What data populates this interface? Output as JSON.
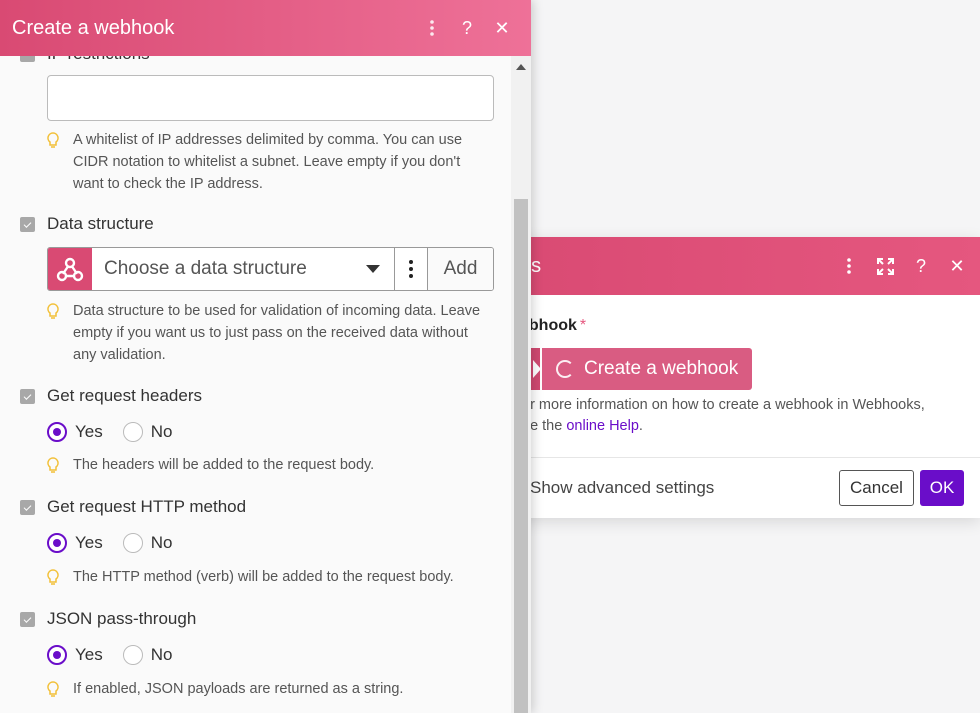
{
  "background_dialog": {
    "title": "oks",
    "field_label": "ebhook",
    "required_mark": "*",
    "create_button_label": "Create a webhook",
    "help_text_line1": "or more information on how to create a webhook in Webhooks,",
    "help_text_line2_prefix": "ee the ",
    "help_link": "online Help",
    "help_text_line2_suffix": ".",
    "advanced_toggle_label": "Show advanced settings",
    "cancel_label": "Cancel",
    "ok_label": "OK"
  },
  "panel": {
    "title": "Create a webhook",
    "ip_restrictions": {
      "title": "IP restrictions",
      "value": "",
      "hint": "A whitelist of IP addresses delimited by comma. You can use CIDR notation to whitelist a subnet. Leave empty if you don't want to check the IP address."
    },
    "data_structure": {
      "title": "Data structure",
      "placeholder": "Choose a data structure",
      "add_label": "Add",
      "hint": "Data structure to be used for validation of incoming data. Leave empty if you want us to just pass on the received data without any validation."
    },
    "get_request_headers": {
      "title": "Get request headers",
      "yes_label": "Yes",
      "no_label": "No",
      "selected": "Yes",
      "hint": "The headers will be added to the request body."
    },
    "get_request_http_method": {
      "title": "Get request HTTP method",
      "yes_label": "Yes",
      "no_label": "No",
      "selected": "Yes",
      "hint": "The HTTP method (verb) will be added to the request body."
    },
    "json_pass_through": {
      "title": "JSON pass-through",
      "yes_label": "Yes",
      "no_label": "No",
      "selected": "Yes",
      "hint": "If enabled, JSON payloads are returned as a string."
    }
  },
  "colors": {
    "brand": "#d94a73",
    "accent": "#6a0dc9",
    "hint_icon": "#f2c038"
  },
  "icons": [
    "more-vertical-icon",
    "help-icon",
    "close-icon",
    "expand-icon",
    "webhook-icon",
    "lightbulb-icon",
    "checkbox-icon",
    "spinner-icon"
  ]
}
